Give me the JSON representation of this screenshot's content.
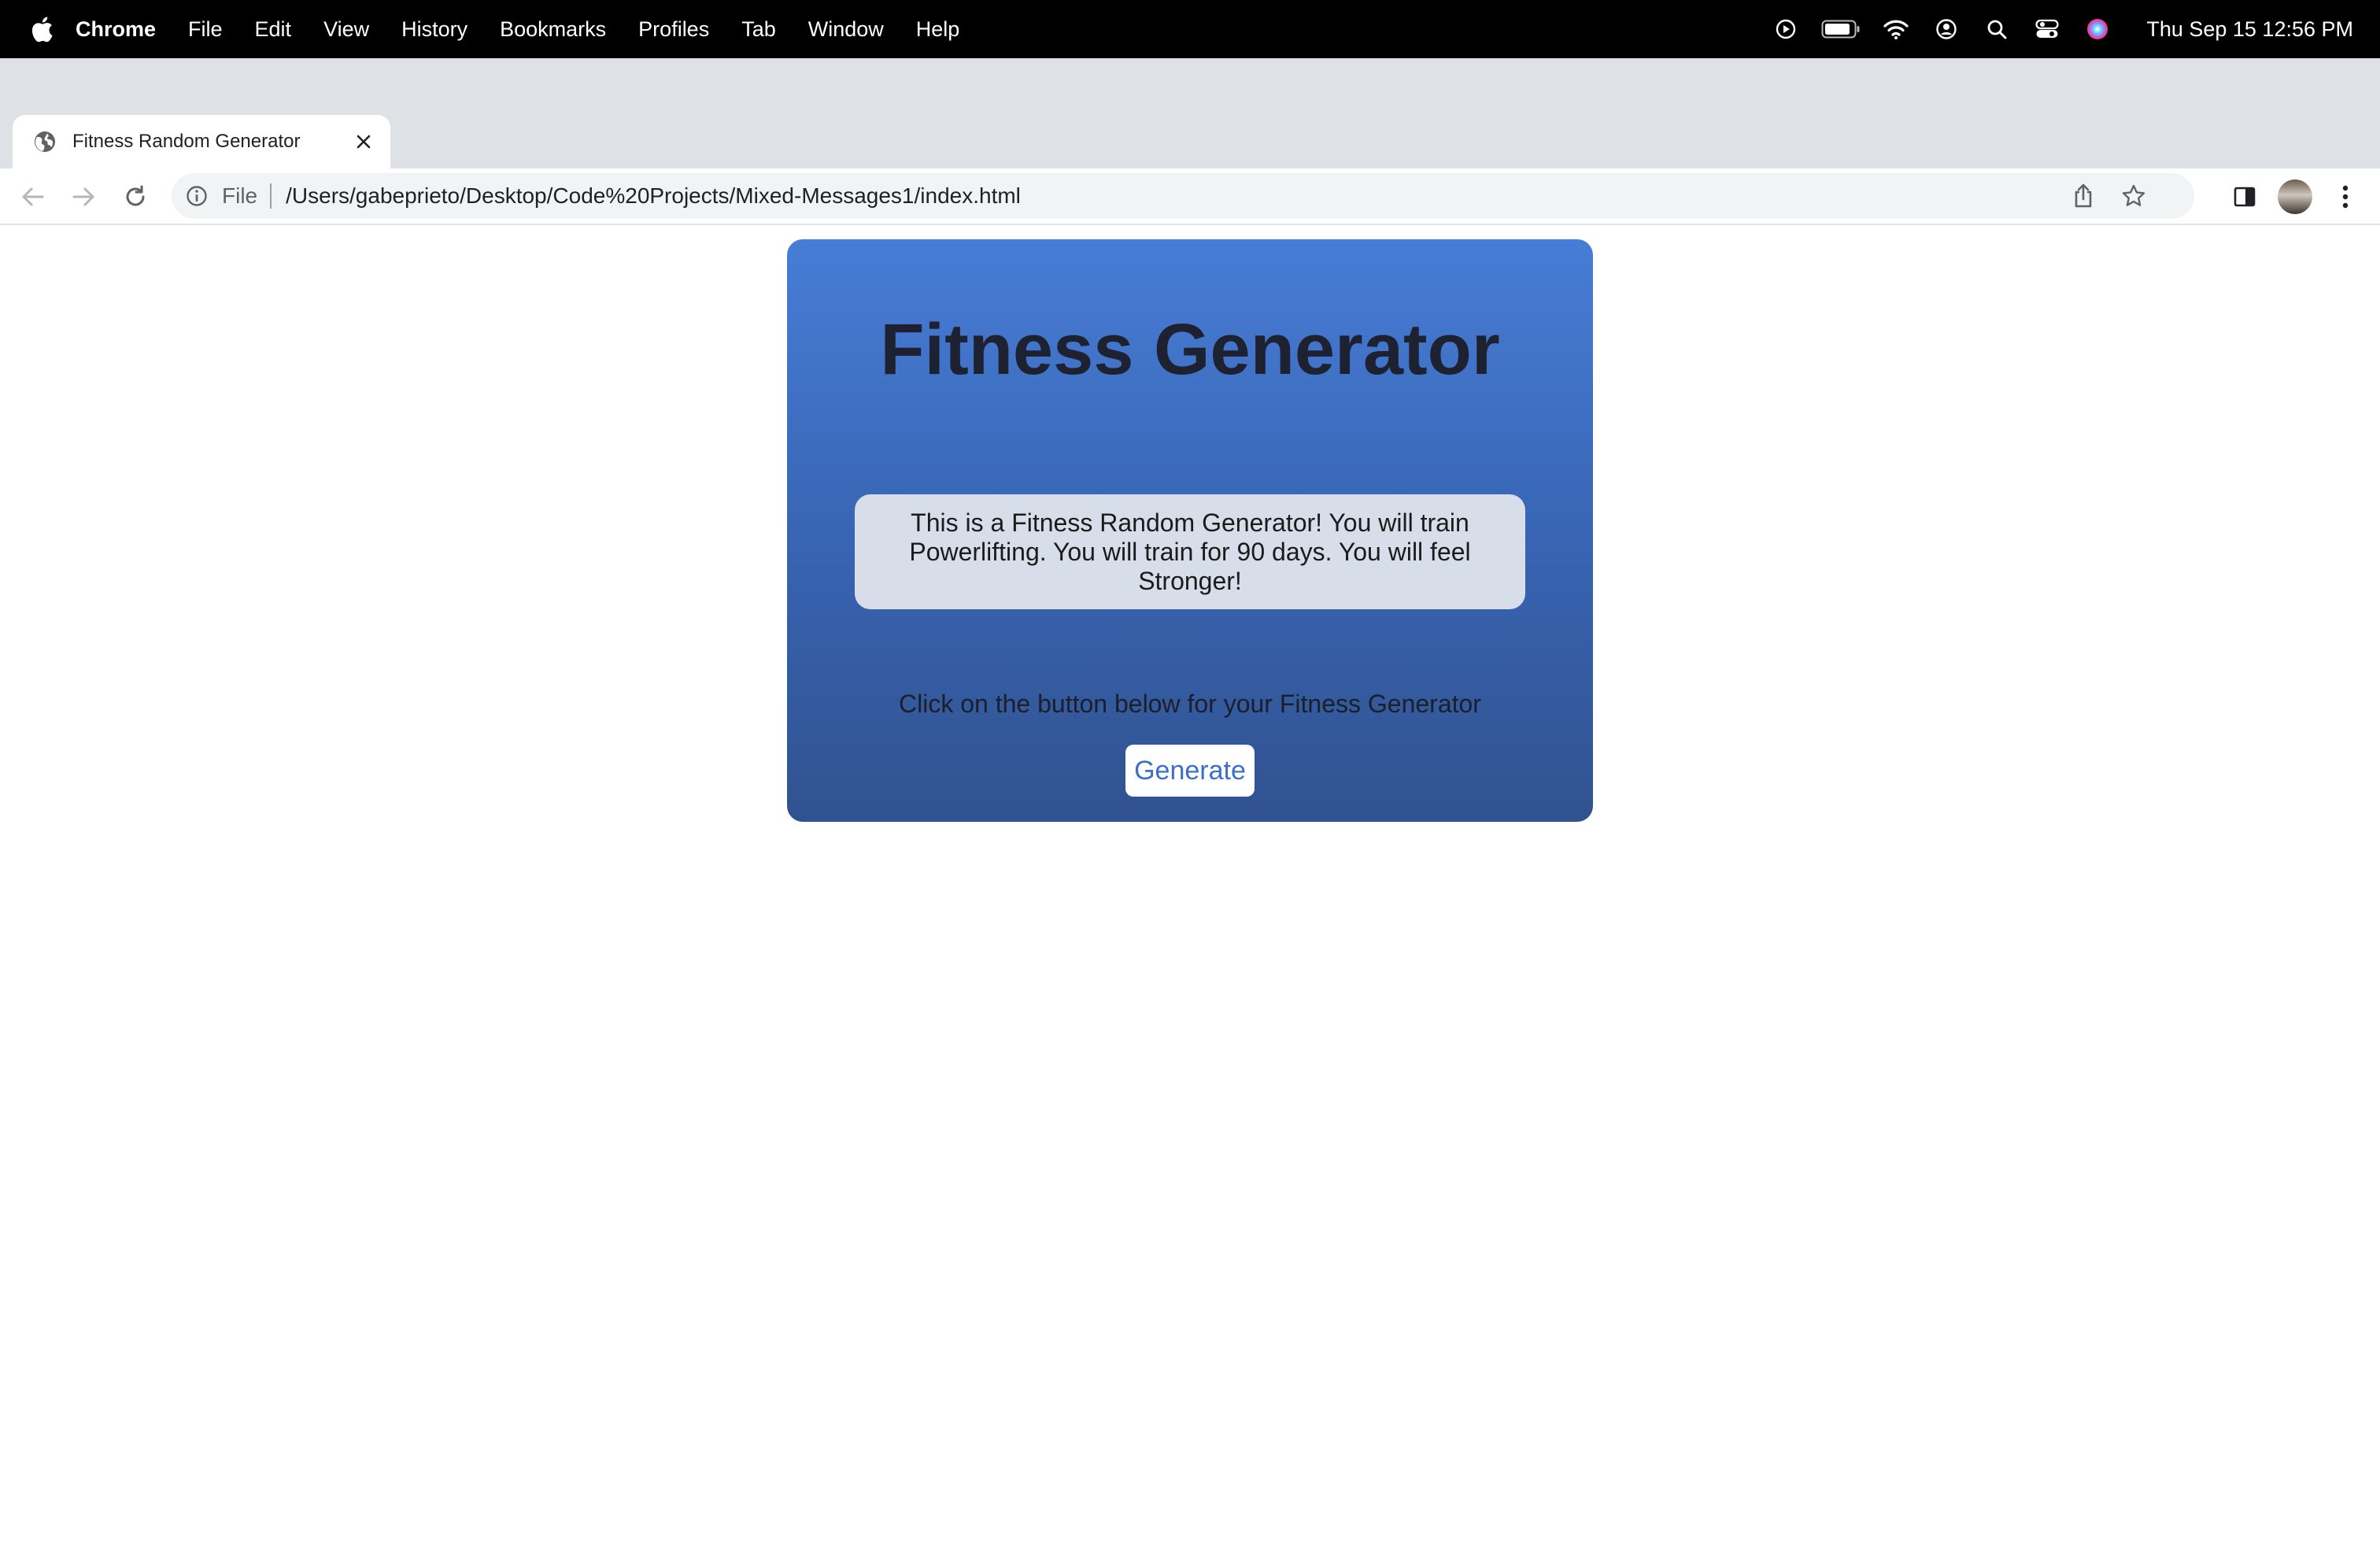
{
  "menubar": {
    "app_name": "Chrome",
    "items": [
      "File",
      "Edit",
      "View",
      "History",
      "Bookmarks",
      "Profiles",
      "Tab",
      "Window",
      "Help"
    ],
    "clock": "Thu Sep 15  12:56 PM",
    "status_icons": [
      "play-icon",
      "battery-icon",
      "wifi-icon",
      "user-icon",
      "spotlight-icon",
      "control-center-icon",
      "siri-icon"
    ]
  },
  "tab": {
    "title": "Fitness Random Generator"
  },
  "toolbar": {
    "scheme": "File",
    "url": "/Users/gabeprieto/Desktop/Code%20Projects/Mixed-Messages1/index.html"
  },
  "page": {
    "title": "Fitness Generator",
    "message": "This is a Fitness Random Generator! You will train Powerlifting. You will train for 90 days. You will feel Stronger!",
    "instruction": "Click on the button below for your Fitness Generator",
    "button_label": "Generate"
  },
  "colors": {
    "card_top": "#477dd6",
    "card_bottom": "#31528f",
    "message_bg": "#d7dee9",
    "button_text": "#3a70c8"
  }
}
